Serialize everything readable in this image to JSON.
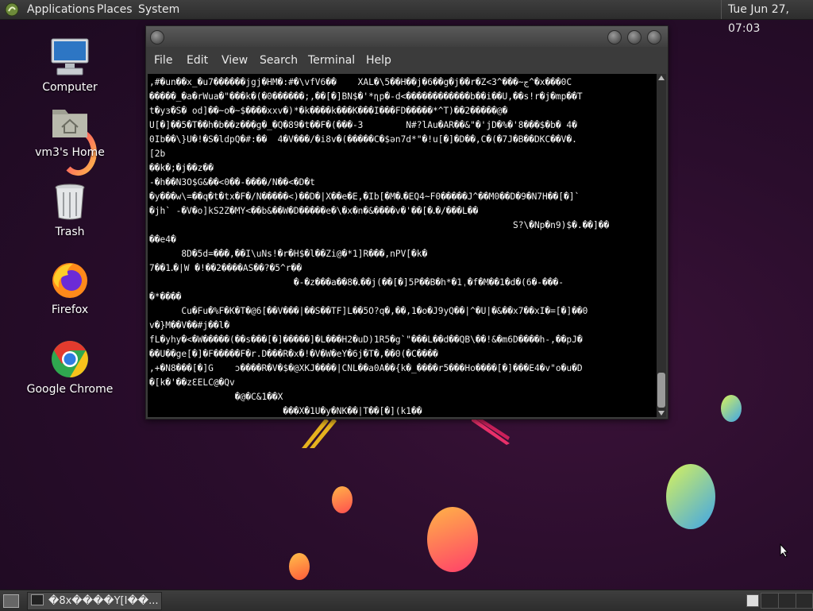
{
  "top_panel": {
    "menus": [
      "Applications",
      "Places",
      "System"
    ],
    "clock": "Tue Jun 27, 07:03"
  },
  "desktop": {
    "icons": [
      {
        "label": "Computer",
        "icon": "computer-icon"
      },
      {
        "label": "vm3's Home",
        "icon": "home-folder-icon"
      },
      {
        "label": "Trash",
        "icon": "trash-icon"
      },
      {
        "label": "Firefox",
        "icon": "firefox-icon"
      },
      {
        "label": "Google Chrome",
        "icon": "chrome-icon"
      }
    ]
  },
  "terminal": {
    "menus": [
      "File",
      "Edit",
      "View",
      "Search",
      "Terminal",
      "Help"
    ],
    "output": ",#�un��x_�u7������jgj�HM�:#�\\vfV6��    XAL�\\5��H��j�6��g�j��r�Z<3^���~ج^�x���0C\n�����_�a�rWua�\"���k�(�0������;,��[�]BN$�'*ɳp�-d<������������b��i��U,��s!r�j�mp��T\nt�yɜ�S� od]��~o�~$����xxv�)*�k����k���K���I���FD�����*^T)��2�����@�\nU[�]��5�T��h�b��z���g�_�Q�89�t��F�(���-3        N#?lAu�AR��&\"�'jD�%�'8���$�b� 4�\n0Ib��\\}U�!�S�ldpQ�#:��  4�V���/�i8v�(�����C�$ən7d*\"�!u[�]�D��,C�(�7J�B��DKC��V�.\n[2b\n��k�;�j��z��\n-�h��N3O$G&��<0��-����/N��<�D�t\n�y���w\\=��q�t�tx�F�/N�����<)��D�|X��e�E,�Ib[�M�ꓸ�EQ4~F0�����J^��M0��D�9�N7H��[�]`\n�jh` -�V�o]kS2Z�MY<��b&��W�D�����e�\\�x�n�&����v�'��[�ꓸ�/���L��\n                                                                    S?\\�Np�n9)$�.��]��\n��e4�\n      8D�5d=���,��I\\uNs!�r�H$�l��Zi@�*1]R���,nPV[�k�\n7��1ꓸ�|W �!��2����AS��?�5^r��\n                           �-�z���a��8�ꓸ��j(��[�]5P��B�h*�1ˌ�f�M��1�d�(6�-���-\n�*����\n      Cu�Fu�%F�K�T�@6[��V���|��S��TF]L��5O?q�,��,1�o�J9yQ��|^�U|�&��x7��xI�=[�]��0\nv�}M��V��#j��l�\nfL�yhy�<�W�����(��s���[�]�����]�L���H2�uD)1R5�g`\"���L��d��QB\\��!&�m6D����h-,��pJ�\n��U��ge[�]�F�����F�r.D���R�x�!�V�W�eY�6j�T�,��0(�C����\n,+�N8���[�]G    ɔ����R�V�$�@XKJ����|CNL��a0A��{k�_����r5���Ho����[�]���E4�v\"o�u�D\n�[k�'��zƐELC@�Qv\n                �@�C&1��X\n                         ���X�1U�y�NK��|T��[�](k1��"
  },
  "taskbar": {
    "task_title": "�8x����Y[I��...",
    "workspaces": 4
  }
}
